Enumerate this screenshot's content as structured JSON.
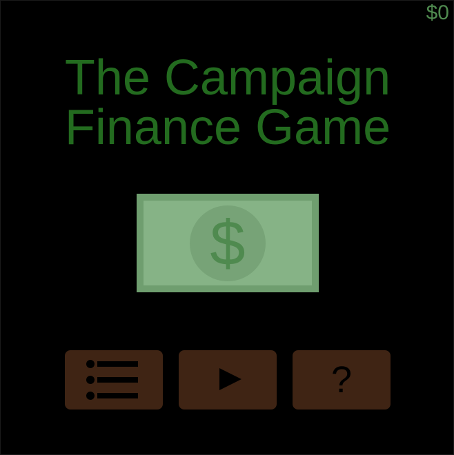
{
  "hud": {
    "money": "$0"
  },
  "title": {
    "line1": "The Campaign",
    "line2": "Finance Game"
  },
  "bill": {
    "symbol": "$",
    "icon": "dollar-bill-icon"
  },
  "menu_buttons": {
    "menu_icon": "list-icon",
    "play_icon": "play-icon",
    "help_icon": "question-mark-icon",
    "help_glyph": "?"
  },
  "colors": {
    "background": "#000000",
    "title": "#236b1f",
    "money": "#4f8a4f",
    "bill_face": "#86b386",
    "bill_border": "#6f9e6f",
    "button": "#3f2414"
  }
}
